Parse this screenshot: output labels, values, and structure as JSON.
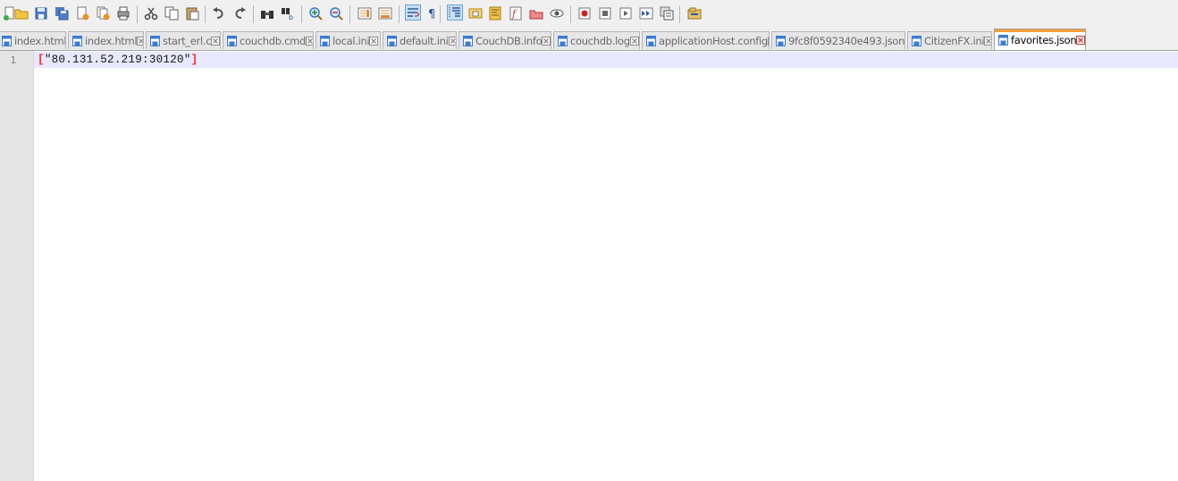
{
  "toolbar": {
    "buttons": [
      {
        "name": "new-file-icon"
      },
      {
        "name": "open-folder-icon"
      },
      {
        "name": "save-icon"
      },
      {
        "name": "save-all-icon"
      },
      {
        "name": "close-icon"
      },
      {
        "name": "close-all-icon"
      },
      {
        "name": "print-icon"
      },
      {
        "name": "cut-icon"
      },
      {
        "name": "copy-icon"
      },
      {
        "name": "paste-icon"
      },
      {
        "name": "undo-icon"
      },
      {
        "name": "redo-icon"
      },
      {
        "name": "find-icon"
      },
      {
        "name": "replace-icon"
      },
      {
        "name": "zoom-in-icon"
      },
      {
        "name": "zoom-out-icon"
      },
      {
        "name": "sync-vertical-icon"
      },
      {
        "name": "sync-horizontal-icon"
      },
      {
        "name": "word-wrap-icon",
        "active": true
      },
      {
        "name": "show-all-chars-icon"
      },
      {
        "name": "indent-guide-icon",
        "active": true
      },
      {
        "name": "user-defined-lang-icon"
      },
      {
        "name": "document-map-icon"
      },
      {
        "name": "function-list-icon"
      },
      {
        "name": "folder-workspace-icon"
      },
      {
        "name": "monitoring-icon"
      },
      {
        "name": "record-macro-icon"
      },
      {
        "name": "stop-record-icon"
      },
      {
        "name": "play-macro-icon"
      },
      {
        "name": "run-macro-multiple-icon"
      },
      {
        "name": "save-macro-icon"
      },
      {
        "name": "plugin-icon"
      }
    ]
  },
  "tabs": [
    {
      "label": "index.html",
      "active": false
    },
    {
      "label": "index.html",
      "active": false
    },
    {
      "label": "start_erl.c",
      "active": false
    },
    {
      "label": "couchdb.cmd",
      "active": false
    },
    {
      "label": "local.ini",
      "active": false
    },
    {
      "label": "default.ini",
      "active": false
    },
    {
      "label": "CouchDB.info",
      "active": false
    },
    {
      "label": "couchdb.log",
      "active": false
    },
    {
      "label": "applicationHost.config",
      "active": false
    },
    {
      "label": "9fc8f0592340e493.json",
      "active": false
    },
    {
      "label": "CitizenFX.ini",
      "active": false
    },
    {
      "label": "favorites.json",
      "active": true
    }
  ],
  "editor": {
    "line_number": "1",
    "open_bracket": "[",
    "string_value": "\"80.131.52.219:30120\"",
    "close_bracket": "]"
  },
  "colors": {
    "accent_tab": "#f9a13a",
    "current_line": "#e8e8ff",
    "bracket": "#ff2a2a",
    "file_icon": "#3a7bd5",
    "close_icon": "#c0392b"
  }
}
